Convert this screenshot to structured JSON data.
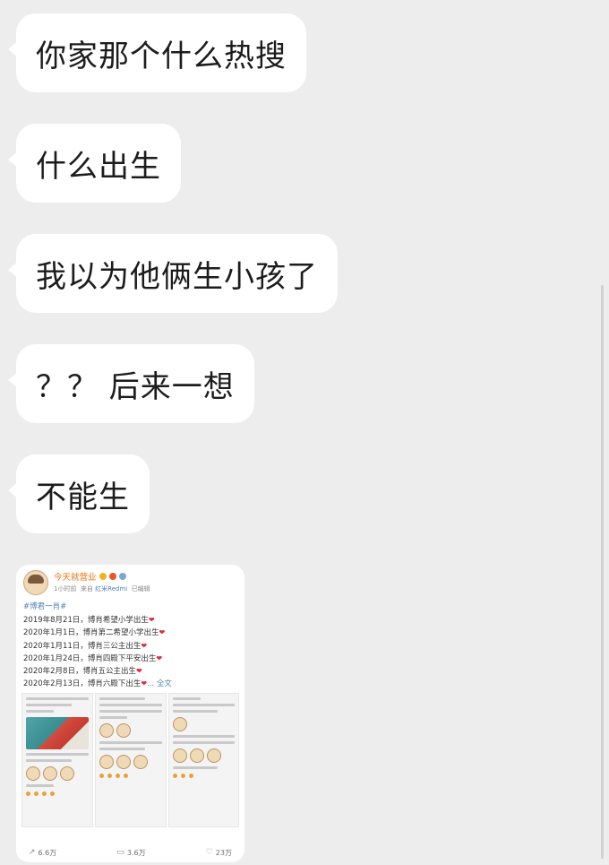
{
  "messages": [
    {
      "text": "你家那个什么热搜"
    },
    {
      "text": "什么出生"
    },
    {
      "text": "我以为他俩生小孩了"
    },
    {
      "text": "？？ 后来一想"
    },
    {
      "text": "不能生"
    }
  ],
  "shared_image": {
    "username": "今天就营业",
    "time": "1小时前",
    "source_prefix": "来自",
    "source": "红米Redmi",
    "edited": "已编辑",
    "topic": "#博君一肖#",
    "lines": [
      "2019年8月21日，博肖希望小学出生",
      "2020年1月1日，博肖第二希望小学出生",
      "2020年1月11日，博肖三公主出生",
      "2020年1月24日，博肖四殿下平安出生",
      "2020年2月8日，博肖五公主出生",
      "2020年2月13日，博肖六殿下出生"
    ],
    "heart": "❤",
    "more": "... 全文",
    "footer": {
      "repost_icon": "repost-icon",
      "repost": "6.6万",
      "comment_icon": "comment-icon",
      "comment": "3.6万",
      "like_icon": "like-icon",
      "like": "23万"
    }
  },
  "colors": {
    "background": "#ededed",
    "bubble": "#ffffff",
    "username": "#e8730c",
    "link": "#4f7fb8",
    "heart": "#e02b3c"
  }
}
